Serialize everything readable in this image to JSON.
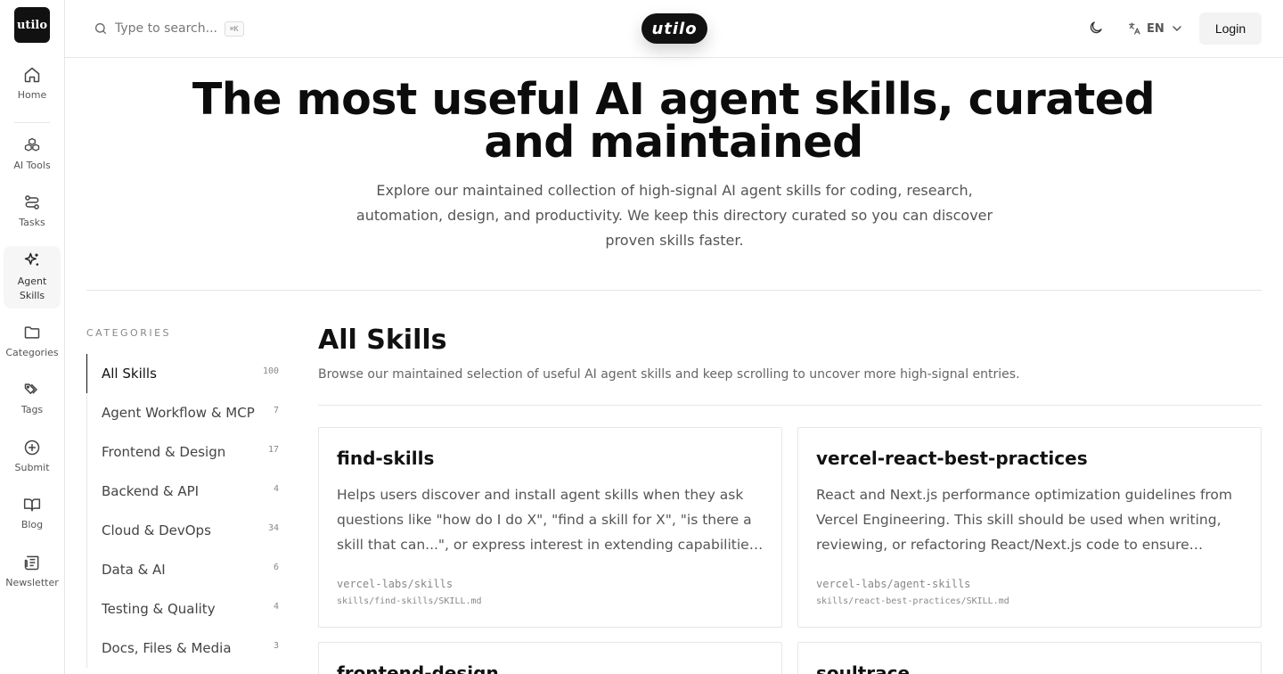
{
  "sidebar": {
    "logo": "utilo",
    "items": [
      {
        "label": "Home",
        "icon": "home-icon"
      },
      {
        "label": "AI Tools",
        "icon": "boxes-icon"
      },
      {
        "label": "Tasks",
        "icon": "workflow-icon"
      },
      {
        "label": "Agent Skills",
        "icon": "sparkles-icon"
      },
      {
        "label": "Categories",
        "icon": "folder-icon"
      },
      {
        "label": "Tags",
        "icon": "tags-icon"
      },
      {
        "label": "Submit",
        "icon": "plus-circle-icon"
      },
      {
        "label": "Blog",
        "icon": "book-icon"
      },
      {
        "label": "Newsletter",
        "icon": "newspaper-icon"
      }
    ]
  },
  "header": {
    "search_placeholder": "Type to search...",
    "search_shortcut": "⌘K",
    "brand": "utilo",
    "language": "EN",
    "login_label": "Login"
  },
  "hero": {
    "title": "The most useful AI agent skills, curated and maintained",
    "subtitle": "Explore our maintained collection of high-signal AI agent skills for coding, research, automation, design, and productivity. We keep this directory curated so you can discover proven skills faster."
  },
  "categories": {
    "heading": "CATEGORIES",
    "items": [
      {
        "label": "All Skills",
        "count": "100"
      },
      {
        "label": "Agent Workflow & MCP",
        "count": "7"
      },
      {
        "label": "Frontend & Design",
        "count": "17"
      },
      {
        "label": "Backend & API",
        "count": "4"
      },
      {
        "label": "Cloud & DevOps",
        "count": "34"
      },
      {
        "label": "Data & AI",
        "count": "6"
      },
      {
        "label": "Testing & Quality",
        "count": "4"
      },
      {
        "label": "Docs, Files & Media",
        "count": "3"
      }
    ]
  },
  "main": {
    "title": "All Skills",
    "subtitle": "Browse our maintained selection of useful AI agent skills and keep scrolling to uncover more high-signal entries.",
    "cards": [
      {
        "title": "find-skills",
        "description": "Helps users discover and install agent skills when they ask questions like \"how do I do X\", \"find a skill for X\", \"is there a skill that can...\", or express interest in extending capabilities. This skill should be used when the user is looking for functionality.",
        "repo": "vercel-labs/skills",
        "path": "skills/find-skills/SKILL.md"
      },
      {
        "title": "vercel-react-best-practices",
        "description": "React and Next.js performance optimization guidelines from Vercel Engineering. This skill should be used when writing, reviewing, or refactoring React/Next.js code to ensure optimal performance patterns.",
        "repo": "vercel-labs/agent-skills",
        "path": "skills/react-best-practices/SKILL.md"
      },
      {
        "title": "frontend-design",
        "description": "",
        "repo": "",
        "path": ""
      },
      {
        "title": "soultrace",
        "description": "",
        "repo": "",
        "path": ""
      }
    ]
  }
}
